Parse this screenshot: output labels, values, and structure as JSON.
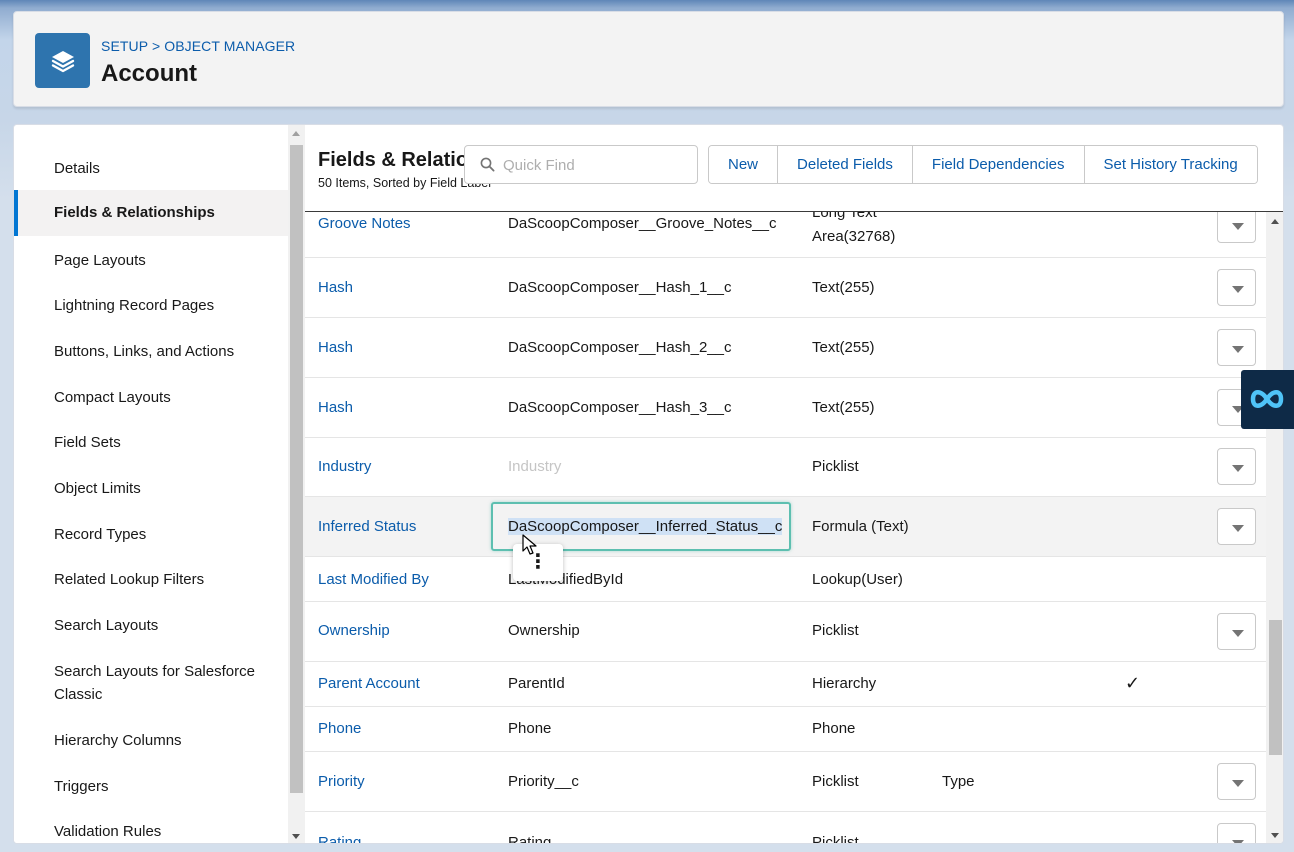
{
  "header": {
    "breadcrumb_part1": "SETUP",
    "breadcrumb_sep": ">",
    "breadcrumb_part2": "OBJECT MANAGER",
    "title": "Account",
    "icon": "layers-icon"
  },
  "sidebar": {
    "items": [
      {
        "label": "Details"
      },
      {
        "label": "Fields & Relationships",
        "active": true
      },
      {
        "label": "Page Layouts"
      },
      {
        "label": "Lightning Record Pages"
      },
      {
        "label": "Buttons, Links, and Actions"
      },
      {
        "label": "Compact Layouts"
      },
      {
        "label": "Field Sets"
      },
      {
        "label": "Object Limits"
      },
      {
        "label": "Record Types"
      },
      {
        "label": "Related Lookup Filters"
      },
      {
        "label": "Search Layouts"
      },
      {
        "label": "Search Layouts for Salesforce Classic"
      },
      {
        "label": "Hierarchy Columns"
      },
      {
        "label": "Triggers"
      },
      {
        "label": "Validation Rules"
      }
    ]
  },
  "section": {
    "title": "Fields & Relationships",
    "subtitle": "50 Items, Sorted by Field Label",
    "quick_find_placeholder": "Quick Find",
    "buttons": {
      "new": "New",
      "deleted_fields": "Deleted Fields",
      "field_dependencies": "Field Dependencies",
      "set_history_tracking": "Set History Tracking"
    }
  },
  "table": {
    "rows": [
      {
        "label": "Groove Notes",
        "api": "DaScoopComposer__Groove_Notes__c",
        "type_line1": "Long Text",
        "type_line2": "Area(32768)"
      },
      {
        "label": "Hash",
        "api": "DaScoopComposer__Hash_1__c",
        "type": "Text(255)"
      },
      {
        "label": "Hash",
        "api": "DaScoopComposer__Hash_2__c",
        "type": "Text(255)"
      },
      {
        "label": "Hash",
        "api": "DaScoopComposer__Hash_3__c",
        "type": "Text(255)"
      },
      {
        "label": "Industry",
        "api": "Industry",
        "type": "Picklist"
      },
      {
        "label": "Inferred Status",
        "api": "DaScoopComposer__Inferred_Status__c",
        "type": "Formula (Text)"
      },
      {
        "label": "Last Modified By",
        "api": "LastModifiedById",
        "type": "Lookup(User)"
      },
      {
        "label": "Ownership",
        "api": "Ownership",
        "type": "Picklist"
      },
      {
        "label": "Parent Account",
        "api": "ParentId",
        "type": "Hierarchy",
        "indexed": "✓"
      },
      {
        "label": "Phone",
        "api": "Phone",
        "type": "Phone"
      },
      {
        "label": "Priority",
        "api": "Priority__c",
        "type": "Picklist",
        "controlling": "Type"
      },
      {
        "label": "Rating",
        "api": "Rating",
        "type": "Picklist"
      }
    ]
  },
  "popover": {
    "icon": "kebab-icon",
    "glyph": "⋮"
  },
  "colors": {
    "brand": "#0176d3",
    "link": "#0b5cab",
    "highlight": "#5dbfb0",
    "badge": "#0e2a47"
  }
}
